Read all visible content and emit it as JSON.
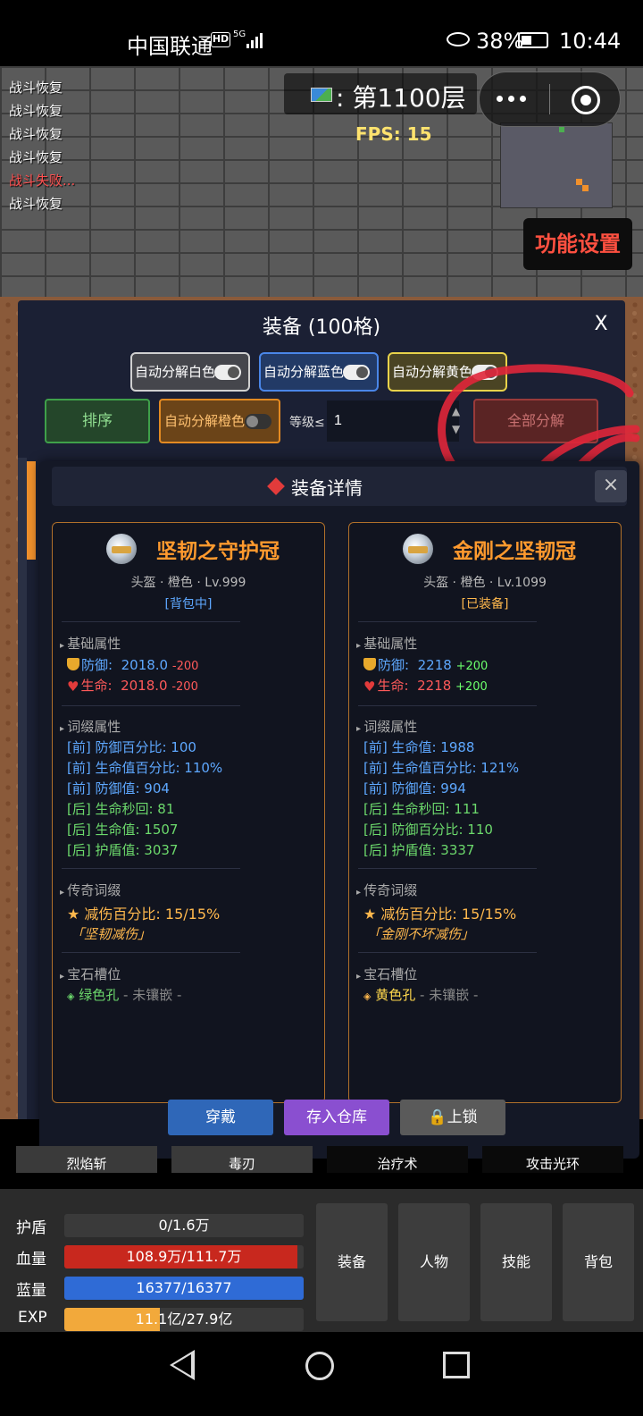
{
  "status_bar": {
    "carrier": "中国联通",
    "hd_badge": "HD",
    "network": "5G",
    "battery": "38%",
    "time": "10:44"
  },
  "game": {
    "combat_log": [
      "战斗恢复",
      "战斗恢复",
      "战斗恢复",
      "战斗恢复",
      "战斗失败...",
      "战斗恢复"
    ],
    "floor": ": 第1100层",
    "fps": "FPS: 15",
    "function_settings": "功能设置"
  },
  "equipment_panel": {
    "title": "装备 (100格)",
    "close": "X",
    "auto_white": "自动分解白色",
    "auto_blue": "自动分解蓝色",
    "auto_yellow": "自动分解黄色",
    "sort": "排序",
    "auto_orange": "自动分解橙色",
    "level_label": "等级≤",
    "level_value": "1",
    "decompose_all": "全部分解"
  },
  "detail": {
    "title": "装备详情",
    "close": "×",
    "left": {
      "name": "坚韧之守护冠",
      "meta": "头盔 · 橙色 · Lv.999",
      "location": "[背包中]",
      "base_section": "基础属性",
      "defense_label": "防御:",
      "defense_value": "2018.0",
      "defense_delta": "-200",
      "hp_label": "生命:",
      "hp_value": "2018.0",
      "hp_delta": "-200",
      "affix_section": "词缀属性",
      "affixes": [
        "[前] 防御百分比: 100",
        "[前] 生命值百分比: 110%",
        "[前] 防御值: 904",
        "[后] 生命秒回: 81",
        "[后] 生命值: 1507",
        "[后] 护盾值: 3037"
      ],
      "legend_section": "传奇词缀",
      "legend_effect": "★ 减伤百分比: 15/15%",
      "legend_name": "「坚韧减伤」",
      "gem_section": "宝石槽位",
      "gem_slot": "绿色孔",
      "gem_state": " - 未镶嵌 -"
    },
    "right": {
      "name": "金刚之坚韧冠",
      "meta": "头盔 · 橙色 · Lv.1099",
      "location": "[已装备]",
      "base_section": "基础属性",
      "defense_label": "防御:",
      "defense_value": "2218",
      "defense_delta": "+200",
      "hp_label": "生命:",
      "hp_value": "2218",
      "hp_delta": "+200",
      "affix_section": "词缀属性",
      "affixes": [
        "[前] 生命值: 1988",
        "[前] 生命值百分比: 121%",
        "[前] 防御值: 994",
        "[后] 生命秒回: 111",
        "[后] 防御百分比: 110",
        "[后] 护盾值: 3337"
      ],
      "legend_section": "传奇词缀",
      "legend_effect": "★ 减伤百分比: 15/15%",
      "legend_name": "「金刚不坏减伤」",
      "gem_section": "宝石槽位",
      "gem_slot": "黄色孔",
      "gem_state": " - 未镶嵌 -"
    },
    "actions": {
      "equip": "穿戴",
      "store": "存入仓库",
      "lock": "上锁"
    }
  },
  "skills": [
    "烈焰斩",
    "毒刃",
    "治疗术",
    "攻击光环"
  ],
  "hud": {
    "shield_label": "护盾",
    "shield_text": "0/1.6万",
    "shield_fraction": 0,
    "hp_label": "血量",
    "hp_text": "108.9万/111.7万",
    "hp_fraction": 0.975,
    "mp_label": "蓝量",
    "mp_text": "16377/16377",
    "mp_fraction": 1.0,
    "exp_label": "EXP",
    "exp_text": "11.1亿/27.9亿",
    "exp_fraction": 0.398,
    "buttons": [
      "装备",
      "人物",
      "技能",
      "背包"
    ]
  },
  "colors": {
    "accent_orange": "#ff9a2e",
    "hp_red": "#c8281e",
    "mp_blue": "#2f6bd6",
    "exp_yellow": "#f2a93b",
    "annotation_red": "#e0263a"
  }
}
